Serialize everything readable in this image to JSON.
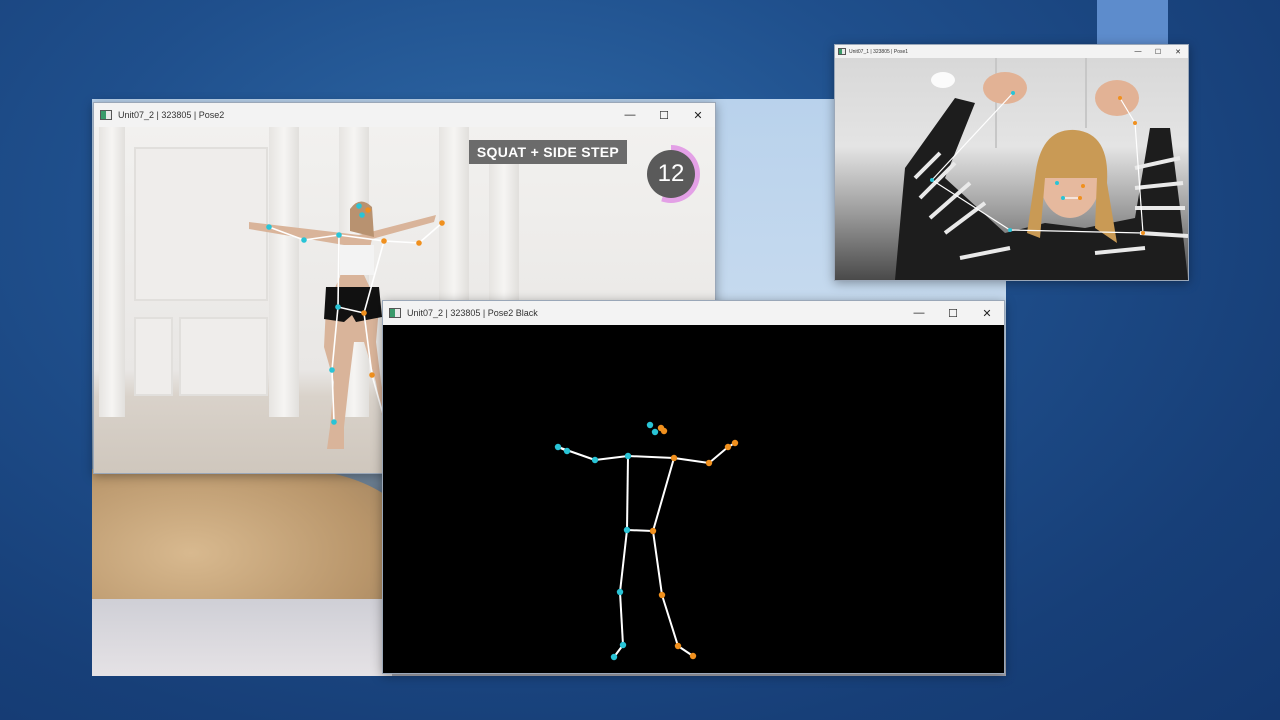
{
  "windows": {
    "pose2": {
      "title": "Unit07_2 | 323805 | Pose2",
      "banner": "SQUAT + SIDE STEP",
      "counter": "12",
      "counter_progress": 0.56
    },
    "pose1": {
      "title": "Unit07_1 | 323805 | Pose1"
    },
    "pose2_black": {
      "title": "Unit07_2 | 323805 | Pose2 Black"
    }
  },
  "controls": {
    "minimize": "—",
    "maximize": "☐",
    "close": "✕"
  },
  "colors": {
    "left_joint": "#29c4d6",
    "right_joint": "#f0901e",
    "bone": "#ffffff",
    "ring": "#e3a0e6",
    "desktop": "#1f4f8c"
  }
}
